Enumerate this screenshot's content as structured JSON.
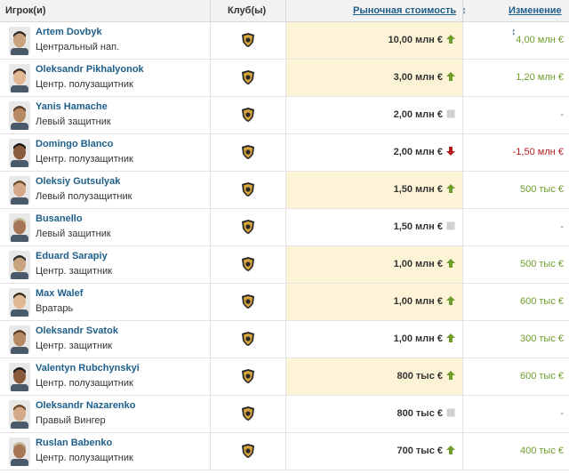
{
  "header": {
    "col_player": "Игрок(и)",
    "col_club": "Клуб(ы)",
    "col_market_value": "Рыночная стоимость",
    "col_change": "Изменение"
  },
  "rows": [
    {
      "name": "Artem Dovbyk",
      "position": "Центральный нап.",
      "value": "10,00 млн €",
      "trend": "up",
      "change": "4,00 млн €",
      "highlight": true
    },
    {
      "name": "Oleksandr Pikhalyonok",
      "position": "Центр. полузащитник",
      "value": "3,00 млн €",
      "trend": "up",
      "change": "1,20 млн €",
      "highlight": true
    },
    {
      "name": "Yanis Hamache",
      "position": "Левый защитник",
      "value": "2,00 млн €",
      "trend": "none",
      "change": "-",
      "highlight": false
    },
    {
      "name": "Domingo Blanco",
      "position": "Центр. полузащитник",
      "value": "2,00 млн €",
      "trend": "down",
      "change": "-1,50 млн €",
      "highlight": false
    },
    {
      "name": "Oleksiy Gutsulyak",
      "position": "Левый полузащитник",
      "value": "1,50 млн €",
      "trend": "up",
      "change": "500 тыс €",
      "highlight": true
    },
    {
      "name": "Busanello",
      "position": "Левый защитник",
      "value": "1,50 млн €",
      "trend": "none",
      "change": "-",
      "highlight": false
    },
    {
      "name": "Eduard Sarapiy",
      "position": "Центр. защитник",
      "value": "1,00 млн €",
      "trend": "up",
      "change": "500 тыс €",
      "highlight": true
    },
    {
      "name": "Max Walef",
      "position": "Вратарь",
      "value": "1,00 млн €",
      "trend": "up",
      "change": "600 тыс €",
      "highlight": true
    },
    {
      "name": "Oleksandr Svatok",
      "position": "Центр. защитник",
      "value": "1,00 млн €",
      "trend": "up",
      "change": "300 тыс €",
      "highlight": false
    },
    {
      "name": "Valentyn Rubchynskyi",
      "position": "Центр. полузащитник",
      "value": "800 тыс €",
      "trend": "up",
      "change": "600 тыс €",
      "highlight": true
    },
    {
      "name": "Oleksandr Nazarenko",
      "position": "Правый Вингер",
      "value": "800 тыс €",
      "trend": "none",
      "change": "-",
      "highlight": false
    },
    {
      "name": "Ruslan Babenko",
      "position": "Центр. полузащитник",
      "value": "700 тыс €",
      "trend": "up",
      "change": "400 тыс €",
      "highlight": false
    }
  ],
  "colors": {
    "up": "#6e9d2b",
    "down": "#b31b1b",
    "neutral": "#777777",
    "highlight": "#fdf4d7"
  },
  "icons": {
    "club": "club-crest-icon",
    "up": "arrow-up-icon",
    "down": "arrow-down-icon",
    "none": "square-neutral-icon",
    "sort": "sort-arrows-icon"
  }
}
